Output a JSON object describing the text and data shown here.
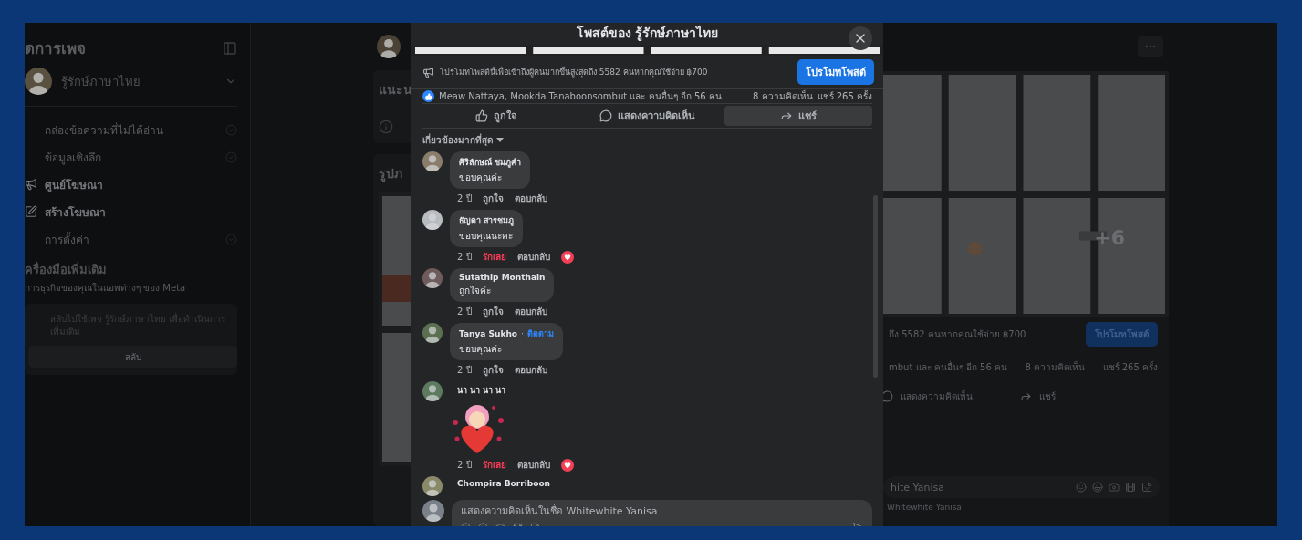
{
  "sidebar": {
    "title": "ดการเพจ",
    "page_name": "รู้รักษ์ภาษาไทย",
    "items": [
      {
        "label": "กล่องข้อความที่ไม่ได้อ่าน",
        "disabled": true
      },
      {
        "label": "ข้อมูลเชิงลึก",
        "disabled": true
      },
      {
        "label": "ศูนย์โฆษณา",
        "disabled": false
      },
      {
        "label": "สร้างโฆษณา",
        "disabled": false
      },
      {
        "label": "การตั้งค่า",
        "disabled": true
      }
    ],
    "tools": {
      "title": "ครื่องมือเพิ่มเติม",
      "subtitle": "การธุรกิจของคุณในแอพต่างๆ ของ Meta"
    },
    "switch_card": {
      "text": "สลับไปใช้เพจ รู้รักษ์ภาษาไทย เพื่อดำเนินการเพิ่มเติม",
      "button": "สลับ"
    }
  },
  "background_post": {
    "intro_title": "แนะน",
    "photos_title": "รูปภ",
    "more_photos": "+6",
    "promo_text": "ถึง 5582 คนหากคุณใช้จ่าย ฿700",
    "promo_button": "โปรโมทโพสต์",
    "reactions_text": "mbut และ คนอื่นๆ อีก 56 คน",
    "comments_count": "8 ความคิดเห็น",
    "shares_count": "แชร์ 265 ครั้ง",
    "actions": [
      "แสดงความคิดเห็น",
      "แชร์"
    ],
    "comment_input": "hite Yanisa",
    "comment_as": "Whitewhite Yanisa"
  },
  "modal": {
    "title": "โพสต์ของ รู้รักษ์ภาษาไทย",
    "promo": {
      "text": "โปรโมทโพสต์นี้เพื่อเข้าถึงผู้คนมากขึ้นสูงสุดถึง 5582 คนหากคุณใช้จ่าย ฿700",
      "button": "โปรโมทโพสต์"
    },
    "reactions": {
      "names": "Meaw Nattaya, Mookda Tanaboonsombut และ คนอื่นๆ อีก 56 คน",
      "comments_count": "8 ความคิดเห็น",
      "shares_count": "แชร์ 265 ครั้ง"
    },
    "actions": [
      {
        "kind": "like",
        "label": "ถูกใจ",
        "hovered": false
      },
      {
        "kind": "comment",
        "label": "แสดงความคิดเห็น",
        "hovered": false
      },
      {
        "kind": "share",
        "label": "แชร์",
        "hovered": true
      }
    ],
    "sort": "เกี่ยวข้องมากที่สุด",
    "comments": [
      {
        "kind": "text",
        "name": "ศิริลักษณ์ ชมภูคำ",
        "text": "ขอบคุณค่ะ",
        "time": "2 ปี",
        "reaction": "ถูกใจ",
        "loved": false,
        "reply": "ตอบกลับ"
      },
      {
        "kind": "text",
        "name": "ธัญดา สารชมภู",
        "text": "ขอบคุณนะคะ",
        "time": "2 ปี",
        "reaction": "รักเลย",
        "loved": true,
        "reply": "ตอบกลับ"
      },
      {
        "kind": "text",
        "name": "Sutathip Monthain",
        "text": "ถูกใจค่ะ",
        "time": "2 ปี",
        "reaction": "ถูกใจ",
        "loved": false,
        "reply": "ตอบกลับ"
      },
      {
        "kind": "text",
        "name": "Tanya Sukho",
        "separator": "·",
        "follow": "ติดตาม",
        "text": "ขอบคุณค่ะ",
        "time": "2 ปี",
        "reaction": "ถูกใจ",
        "loved": false,
        "reply": "ตอบกลับ"
      },
      {
        "kind": "sticker",
        "name": "นา นา นา นา",
        "time": "2 ปี",
        "reaction": "รักเลย",
        "loved": true,
        "reply": "ตอบกลับ"
      },
      {
        "kind": "partial",
        "name": "Chompira Borriboon"
      }
    ],
    "comment_input": {
      "placeholder": "แสดงความคิดเห็นในชื่อ Whitewhite Yanisa"
    }
  }
}
